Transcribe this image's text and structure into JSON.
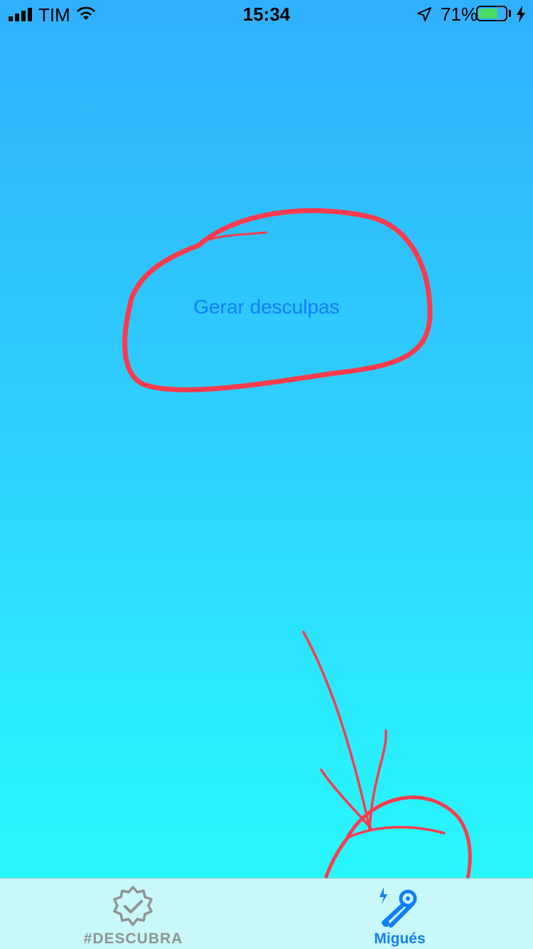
{
  "status_bar": {
    "carrier": "TIM",
    "time": "15:34",
    "battery_percent": "71%",
    "battery_level": 0.71,
    "icons": [
      "cellular-signal-icon",
      "wifi-icon",
      "location-arrow-icon",
      "battery-icon",
      "charging-bolt-icon"
    ]
  },
  "main": {
    "action_label": "Gerar desculpas"
  },
  "tab_bar": {
    "tabs": [
      {
        "label": "#DESCUBRA",
        "icon": "verified-badge-icon",
        "active": false
      },
      {
        "label": "Migués",
        "icon": "safety-pin-bolt-icon",
        "active": true
      }
    ]
  },
  "colors": {
    "accent": "#127ffb",
    "annotation": "#fa3b4d",
    "inactive_tab": "#8e9494",
    "tab_bar_bg": "#c8f8fa"
  }
}
